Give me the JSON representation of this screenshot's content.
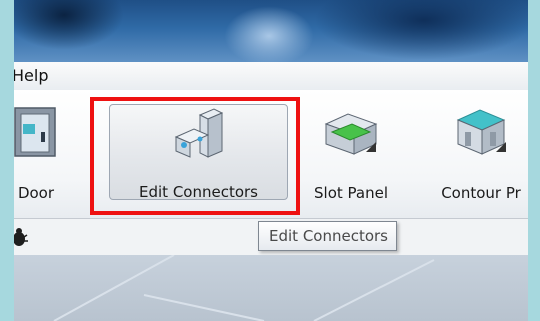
{
  "menu": {
    "help_label": "Help"
  },
  "ribbon": {
    "buttons": [
      {
        "label": "Door",
        "icon": "door-icon"
      },
      {
        "label": "Edit Connectors",
        "icon": "edit-connectors-icon",
        "state": "hover"
      },
      {
        "label": "Slot Panel",
        "icon": "slot-panel-icon"
      },
      {
        "label": "Contour Pr",
        "icon": "contour-icon"
      }
    ]
  },
  "tooltip": {
    "text": "Edit Connectors"
  },
  "toolbar": {
    "icon": "bug-icon"
  },
  "colors": {
    "highlight": "#ee1111",
    "titlebar": "#2f6aa6",
    "frame": "#a6d8de",
    "slot_green": "#48c24a",
    "accent_teal": "#43c1c9"
  }
}
